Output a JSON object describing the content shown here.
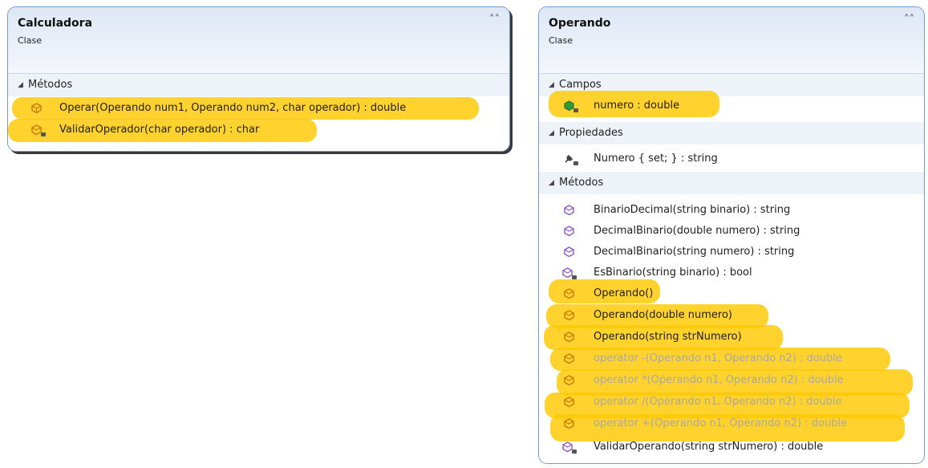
{
  "classes": {
    "calculadora": {
      "name": "Calculadora",
      "stereotype": "Clase",
      "sections": {
        "metodos": "Métodos"
      },
      "methods": [
        "Operar(Operando num1, Operando num2, char operador) : double",
        "ValidarOperador(char operador) : char"
      ]
    },
    "operando": {
      "name": "Operando",
      "stereotype": "Clase",
      "sections": {
        "campos": "Campos",
        "propiedades": "Propiedades",
        "metodos": "Métodos"
      },
      "fields": [
        "numero : double"
      ],
      "properties": [
        "Numero { set; } : string"
      ],
      "methods": [
        "BinarioDecimal(string binario) : string",
        "DecimalBinario(double numero) : string",
        "DecimalBinario(string numero) : string",
        "EsBinario(string binario) : bool",
        "Operando()",
        "Operando(double numero)",
        "Operando(string strNumero)",
        "operator -(Operando n1, Operando n2) : double",
        "operator *(Operando n1, Operando n2) : double",
        "operator /(Operando n1, Operando n2) : double",
        "operator +(Operando n1, Operando n2) : double",
        "ValidarOperando(string strNumero) : double"
      ]
    }
  },
  "icons": {
    "collapse": "double-chevron-up-icon",
    "section_toggle": "triangle-down-icon",
    "method": "method-cube-icon",
    "field": "field-icon",
    "property": "property-wrench-icon",
    "private": "lock-icon"
  },
  "colors": {
    "highlight": "#ffc800",
    "border": "#6f9cd4",
    "method_icon": "#8a55c7",
    "field_icon": "#2f9a3a"
  }
}
